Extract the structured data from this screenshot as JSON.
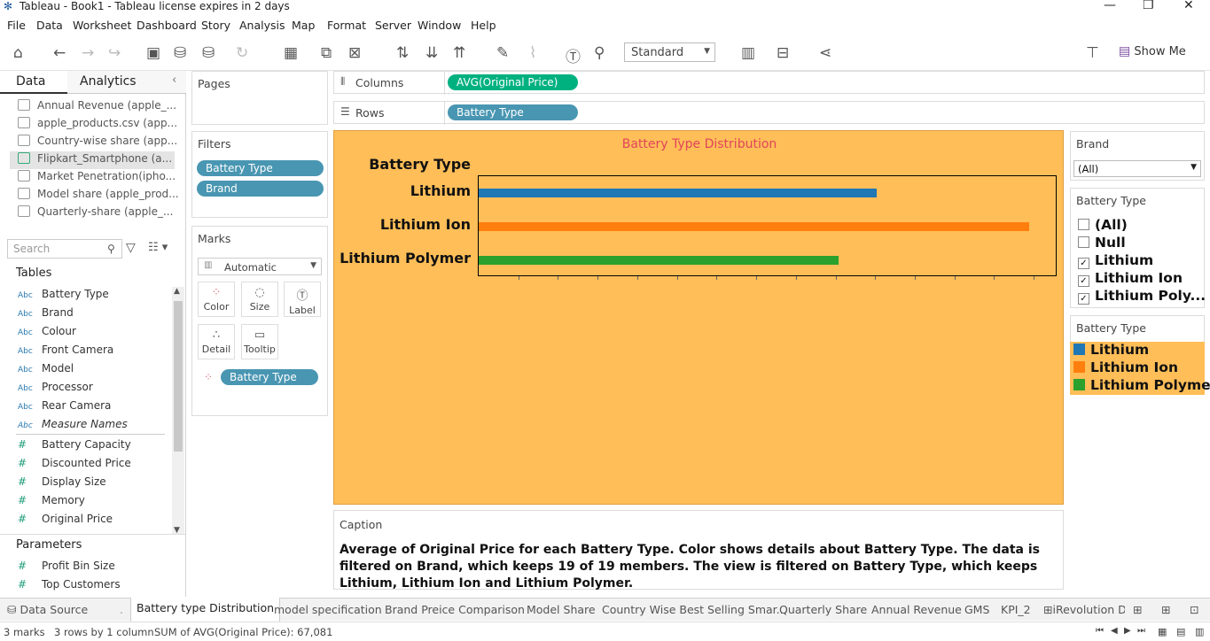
{
  "window": {
    "title": "Tableau - Book1 - Tableau license expires in 2 days"
  },
  "menu": [
    "File",
    "Data",
    "Worksheet",
    "Dashboard",
    "Story",
    "Analysis",
    "Map",
    "Format",
    "Server",
    "Window",
    "Help"
  ],
  "toolbar": {
    "fit_value": "Standard",
    "show_me": "Show Me"
  },
  "left_pane": {
    "tabs": [
      "Data",
      "Analytics"
    ],
    "sources": [
      "Annual Revenue (apple_...",
      "apple_products.csv (app...",
      "Country-wise share (app...",
      "Flipkart_Smartphone (a...",
      "Market Penetration(ipho...",
      "Model share (apple_prod...",
      "Quarterly-share (apple_..."
    ],
    "search_placeholder": "Search",
    "tables_header": "Tables",
    "dimensions": [
      "Battery Type",
      "Brand",
      "Colour",
      "Front Camera",
      "Model",
      "Processor",
      "Rear Camera",
      "Measure Names"
    ],
    "dim_badge": "Abc",
    "measures": [
      "Battery Capacity",
      "Discounted Price",
      "Display Size",
      "Memory",
      "Original Price"
    ],
    "measure_badge": "#",
    "parameters_header": "Parameters",
    "parameters": [
      "Profit Bin Size",
      "Top Customers"
    ]
  },
  "pages_card": {
    "title": "Pages"
  },
  "filters_card": {
    "title": "Filters",
    "pills": [
      "Battery Type",
      "Brand"
    ]
  },
  "marks_card": {
    "title": "Marks",
    "type": "Automatic",
    "buttons": [
      "Color",
      "Size",
      "Label",
      "Detail",
      "Tooltip"
    ],
    "pill": "Battery Type"
  },
  "shelves": {
    "columns_label": "Columns",
    "columns_pill": "AVG(Original Price)",
    "rows_label": "Rows",
    "rows_pill": "Battery Type"
  },
  "colors": {
    "viz_bg": "#ffbe58",
    "lithium": "#1f77b4",
    "lithium_ion": "#ff7f0e",
    "lithium_polymer": "#2ca02c",
    "title": "#e0455b"
  },
  "chart_data": {
    "type": "bar",
    "orientation": "horizontal",
    "title": "Battery Type Distribution",
    "row_header": "Battery Type",
    "categories": [
      "Lithium",
      "Lithium Ion",
      "Lithium Polymer"
    ],
    "values": [
      49500,
      68500,
      44800
    ],
    "xlim": [
      0,
      72000
    ],
    "grid": false
  },
  "caption": {
    "title": "Caption",
    "text": "Average of Original Price for each Battery Type.  Color shows details about Battery Type. The data is filtered on Brand, which keeps 19 of 19 members. The view is filtered on Battery Type, which keeps Lithium, Lithium Ion and Lithium Polymer."
  },
  "brand_filter": {
    "title": "Brand",
    "value": "(All)"
  },
  "battery_filter": {
    "title": "Battery Type",
    "items": [
      {
        "label": "(All)",
        "checked": false
      },
      {
        "label": "Null",
        "checked": false
      },
      {
        "label": "Lithium",
        "checked": true
      },
      {
        "label": "Lithium Ion",
        "checked": true
      },
      {
        "label": "Lithium Poly...",
        "checked": true
      }
    ]
  },
  "legend": {
    "title": "Battery Type",
    "items": [
      "Lithium",
      "Lithium Ion",
      "Lithium Polymer"
    ]
  },
  "sheet_tabs": [
    "Data Source",
    "Battery type Distribution",
    "model specification",
    "Brand Preice Comparison",
    "Model Share",
    "Country Wise Best Selling Smar...",
    "Quarterly Share",
    "Annual Revenue",
    "GMS",
    "KPI_2",
    "iRevolution Da"
  ],
  "status": {
    "marks": "3 marks",
    "dims": "3 rows by 1 column",
    "sum": "SUM of AVG(Original Price): 67,081"
  }
}
